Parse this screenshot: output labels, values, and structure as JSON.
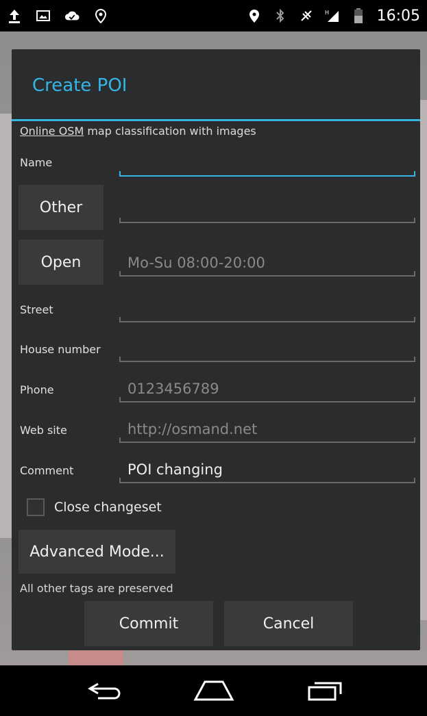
{
  "status_bar": {
    "time": "16:05",
    "left_icons": [
      "upload-icon",
      "image-icon",
      "cloud-check-icon",
      "location-outline-icon"
    ],
    "right_icons": [
      "location-icon",
      "bluetooth-icon",
      "signal-off-icon",
      "cellular-signal-icon",
      "battery-icon"
    ]
  },
  "dialog": {
    "title": "Create POI",
    "info": {
      "link_text": "Online OSM",
      "rest_text": " map classification with images"
    },
    "fields": {
      "name": {
        "label": "Name",
        "value": "",
        "placeholder": ""
      },
      "type": {
        "button_label": "Other",
        "value": ""
      },
      "opening_hours": {
        "button_label": "Open",
        "placeholder": "Mo-Su 08:00-20:00"
      },
      "street": {
        "label": "Street",
        "value": ""
      },
      "house_number": {
        "label": "House number",
        "value": ""
      },
      "phone": {
        "label": "Phone",
        "placeholder": "0123456789"
      },
      "web_site": {
        "label": "Web site",
        "placeholder": "http://osmand.net"
      },
      "comment": {
        "label": "Comment",
        "value": "POI changing"
      }
    },
    "close_changeset": {
      "label": "Close changeset",
      "checked": false
    },
    "advanced_mode_label": "Advanced Mode...",
    "note": "All other tags are preserved",
    "commit_label": "Commit",
    "cancel_label": "Cancel"
  },
  "colors": {
    "accent": "#33b5e5",
    "dialog_bg": "#2b2c2e",
    "button_bg": "#383a3c"
  },
  "nav_bar": {
    "buttons": [
      "back-icon",
      "home-icon",
      "recents-icon"
    ]
  }
}
